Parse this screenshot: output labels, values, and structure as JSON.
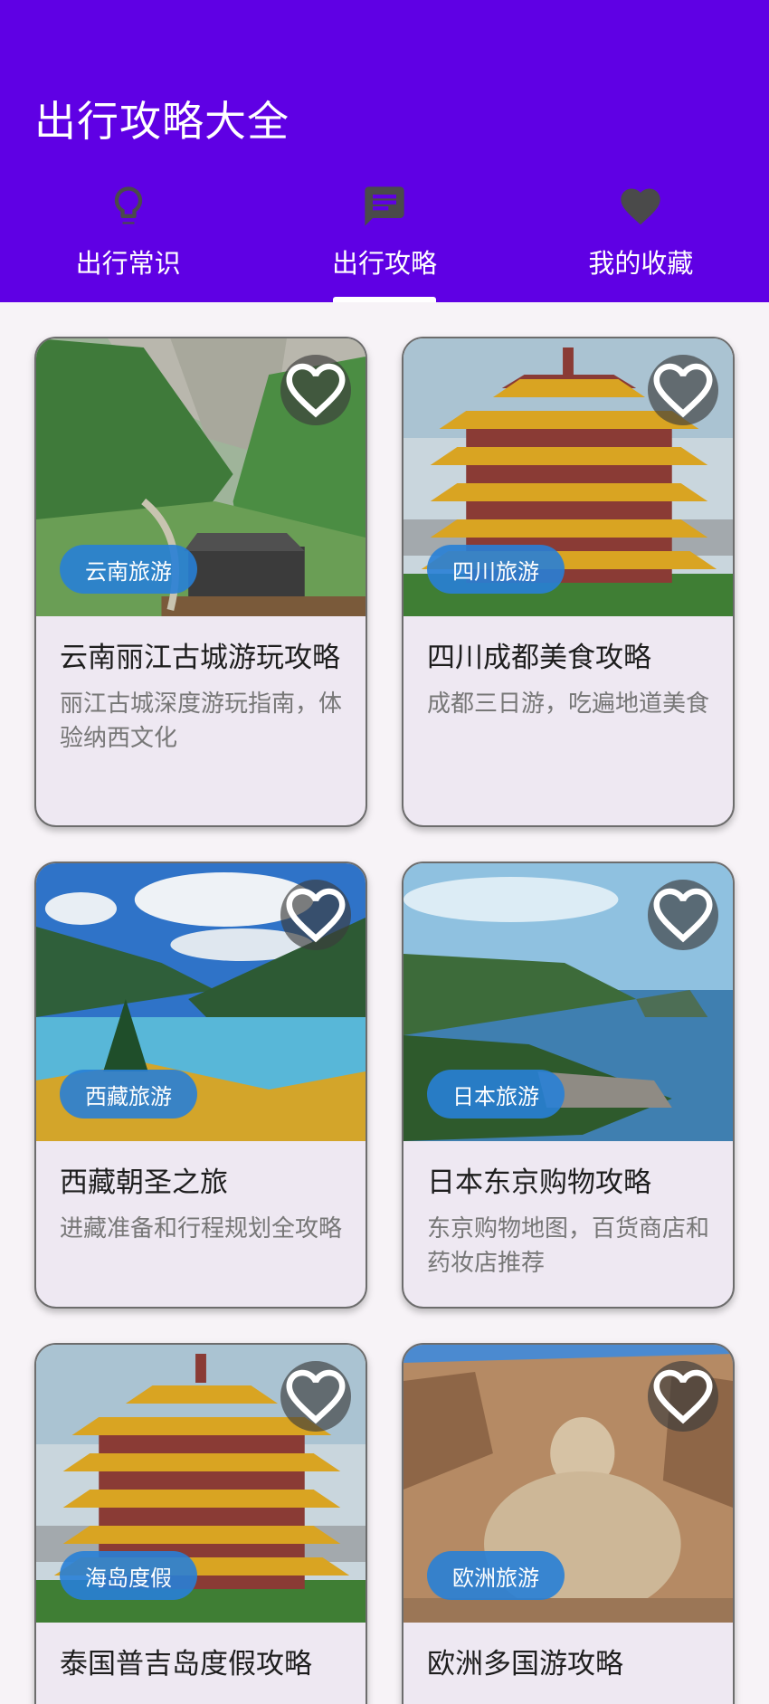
{
  "app": {
    "title": "出行攻略大全"
  },
  "tabs": [
    {
      "label": "出行常识",
      "icon": "lightbulb-icon",
      "selected": false
    },
    {
      "label": "出行攻略",
      "icon": "chat-icon",
      "selected": true
    },
    {
      "label": "我的收藏",
      "icon": "heart-icon",
      "selected": false
    }
  ],
  "guides": [
    {
      "tag": "云南旅游",
      "title": "云南丽江古城游玩攻略",
      "desc": "丽江古城深度游玩指南，体验纳西文化",
      "image": "green-canyon-valley"
    },
    {
      "tag": "四川旅游",
      "title": "四川成都美食攻略",
      "desc": "成都三日游，吃遍地道美食",
      "image": "yellow-crane-tower"
    },
    {
      "tag": "西藏旅游",
      "title": "西藏朝圣之旅",
      "desc": "进藏准备和行程规划全攻略",
      "image": "mountain-lake"
    },
    {
      "tag": "日本旅游",
      "title": "日本东京购物攻略",
      "desc": "东京购物地图，百货商店和药妆店推荐",
      "image": "coastal-headland"
    },
    {
      "tag": "海岛度假",
      "title": "泰国普吉岛度假攻略",
      "desc": "",
      "image": "yellow-crane-tower"
    },
    {
      "tag": "欧洲旅游",
      "title": "欧洲多国游攻略",
      "desc": "",
      "image": "stone-buddha-grotto"
    }
  ],
  "colors": {
    "primary": "#5F00E4",
    "chip": "#2880D6",
    "card": "#EEE8F2",
    "background": "#F7F3F7"
  }
}
